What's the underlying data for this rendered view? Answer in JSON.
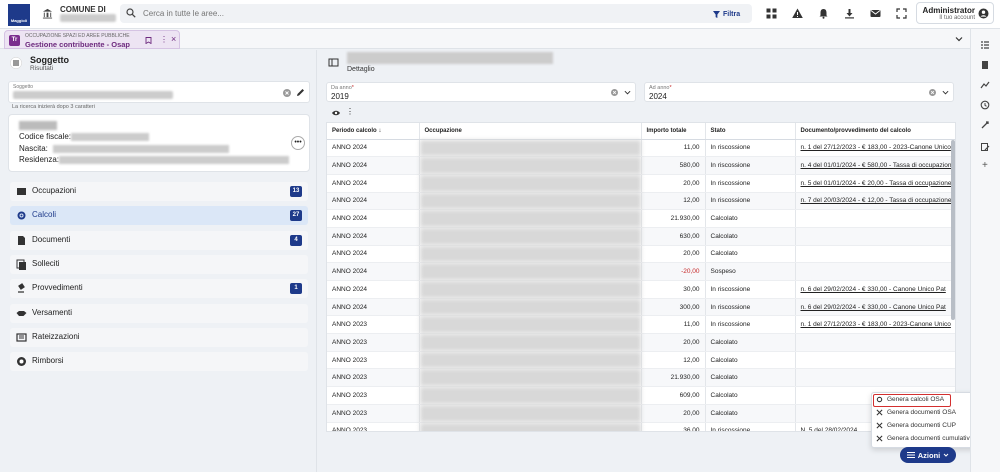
{
  "header": {
    "logo_text": "Maggioli",
    "municipality_label": "COMUNE DI",
    "search_placeholder": "Cerca in tutte le aree...",
    "filter_label": "Filtra",
    "user_name": "Administrator",
    "user_sub": "Il tuo account"
  },
  "tab": {
    "badge": "Tr",
    "supertitle": "OCCUPAZIONE SPAZI ED AREE PUBBLICHE",
    "title": "Gestione contribuente - Osap"
  },
  "left": {
    "title": "Soggetto",
    "subtitle": "Risultati",
    "soggetto_label": "Soggetto",
    "hint": "La ricerca inizierà dopo 3 caratteri",
    "fields": [
      {
        "label": "Codice fiscale:"
      },
      {
        "label": "Nascita:"
      },
      {
        "label": "Residenza:"
      }
    ],
    "more_label": "•••",
    "nav": [
      {
        "label": "Occupazioni",
        "badge": "13",
        "icon": "occupations-icon"
      },
      {
        "label": "Calcoli",
        "badge": "27",
        "icon": "gear-icon"
      },
      {
        "label": "Documenti",
        "badge": "4",
        "icon": "document-icon"
      },
      {
        "label": "Solleciti",
        "badge": "",
        "icon": "reminders-icon"
      },
      {
        "label": "Provvedimenti",
        "badge": "1",
        "icon": "gavel-icon"
      },
      {
        "label": "Versamenti",
        "badge": "",
        "icon": "handshake-icon"
      },
      {
        "label": "Rateizzazioni",
        "badge": "",
        "icon": "installments-icon"
      },
      {
        "label": "Rimborsi",
        "badge": "",
        "icon": "refund-icon"
      }
    ]
  },
  "right": {
    "detail_label": "Dettaglio",
    "from_year": {
      "label": "Da anno",
      "value": "2019"
    },
    "to_year": {
      "label": "Ad anno",
      "value": "2024"
    },
    "columns": [
      "Periodo calcolo",
      "Occupazione",
      "Importo totale",
      "Stato",
      "Documento/provvedimento del calcolo"
    ],
    "sort_indicator": "↓",
    "rows": [
      {
        "periodo": "ANNO 2024",
        "importo": "11,00",
        "stato": "In riscossione",
        "doc": "n. 1 del 27/12/2023 - € 183,00 - 2023-Canone Unico",
        "link": true,
        "neg": false
      },
      {
        "periodo": "ANNO 2024",
        "importo": "580,00",
        "stato": "In riscossione",
        "doc": "n. 4 del 01/01/2024 - € 580,00 - Tassa di occupazione",
        "link": true,
        "neg": false
      },
      {
        "periodo": "ANNO 2024",
        "importo": "20,00",
        "stato": "In riscossione",
        "doc": "n. 5 del 01/01/2024 - € 20,00 - Tassa di occupazione",
        "link": true,
        "neg": false
      },
      {
        "periodo": "ANNO 2024",
        "importo": "12,00",
        "stato": "In riscossione",
        "doc": "n. 7 del 20/03/2024 - € 12,00 - Tassa di occupazione",
        "link": true,
        "neg": false
      },
      {
        "periodo": "ANNO 2024",
        "importo": "21.930,00",
        "stato": "Calcolato",
        "doc": "",
        "link": false,
        "neg": false
      },
      {
        "periodo": "ANNO 2024",
        "importo": "630,00",
        "stato": "Calcolato",
        "doc": "",
        "link": false,
        "neg": false
      },
      {
        "periodo": "ANNO 2024",
        "importo": "20,00",
        "stato": "Calcolato",
        "doc": "",
        "link": false,
        "neg": false
      },
      {
        "periodo": "ANNO 2024",
        "importo": "-20,00",
        "stato": "Sospeso",
        "doc": "",
        "link": false,
        "neg": true
      },
      {
        "periodo": "ANNO 2024",
        "importo": "30,00",
        "stato": "In riscossione",
        "doc": "n. 6 del 29/02/2024 - € 330,00 - Canone Unico Pat",
        "link": true,
        "neg": false
      },
      {
        "periodo": "ANNO 2024",
        "importo": "300,00",
        "stato": "In riscossione",
        "doc": "n. 6 del 29/02/2024 - € 330,00 - Canone Unico Pat",
        "link": true,
        "neg": false
      },
      {
        "periodo": "ANNO 2023",
        "importo": "11,00",
        "stato": "In riscossione",
        "doc": "n. 1 del 27/12/2023 - € 183,00 - 2023-Canone Unico",
        "link": true,
        "neg": false
      },
      {
        "periodo": "ANNO 2023",
        "importo": "20,00",
        "stato": "Calcolato",
        "doc": "",
        "link": false,
        "neg": false
      },
      {
        "periodo": "ANNO 2023",
        "importo": "12,00",
        "stato": "Calcolato",
        "doc": "",
        "link": false,
        "neg": false
      },
      {
        "periodo": "ANNO 2023",
        "importo": "21.930,00",
        "stato": "Calcolato",
        "doc": "",
        "link": false,
        "neg": false
      },
      {
        "periodo": "ANNO 2023",
        "importo": "609,00",
        "stato": "Calcolato",
        "doc": "",
        "link": false,
        "neg": false
      },
      {
        "periodo": "ANNO 2023",
        "importo": "20,00",
        "stato": "Calcolato",
        "doc": "",
        "link": false,
        "neg": false
      },
      {
        "periodo": "ANNO 2023",
        "importo": "36,00",
        "stato": "In riscossione",
        "doc": "N. 5 del 28/02/2024",
        "link": false,
        "neg": false
      }
    ],
    "actions": [
      {
        "label": "Genera calcoli OSA"
      },
      {
        "label": "Genera documenti OSA"
      },
      {
        "label": "Genera documenti CUP"
      },
      {
        "label": "Genera documenti cumulativi CUP"
      }
    ],
    "azioni_label": "Azioni"
  },
  "colors": {
    "primary": "#1e3a8a",
    "tab_accent": "#7b2d8e",
    "highlight": "#d32f2f",
    "negative": "#c62828"
  }
}
